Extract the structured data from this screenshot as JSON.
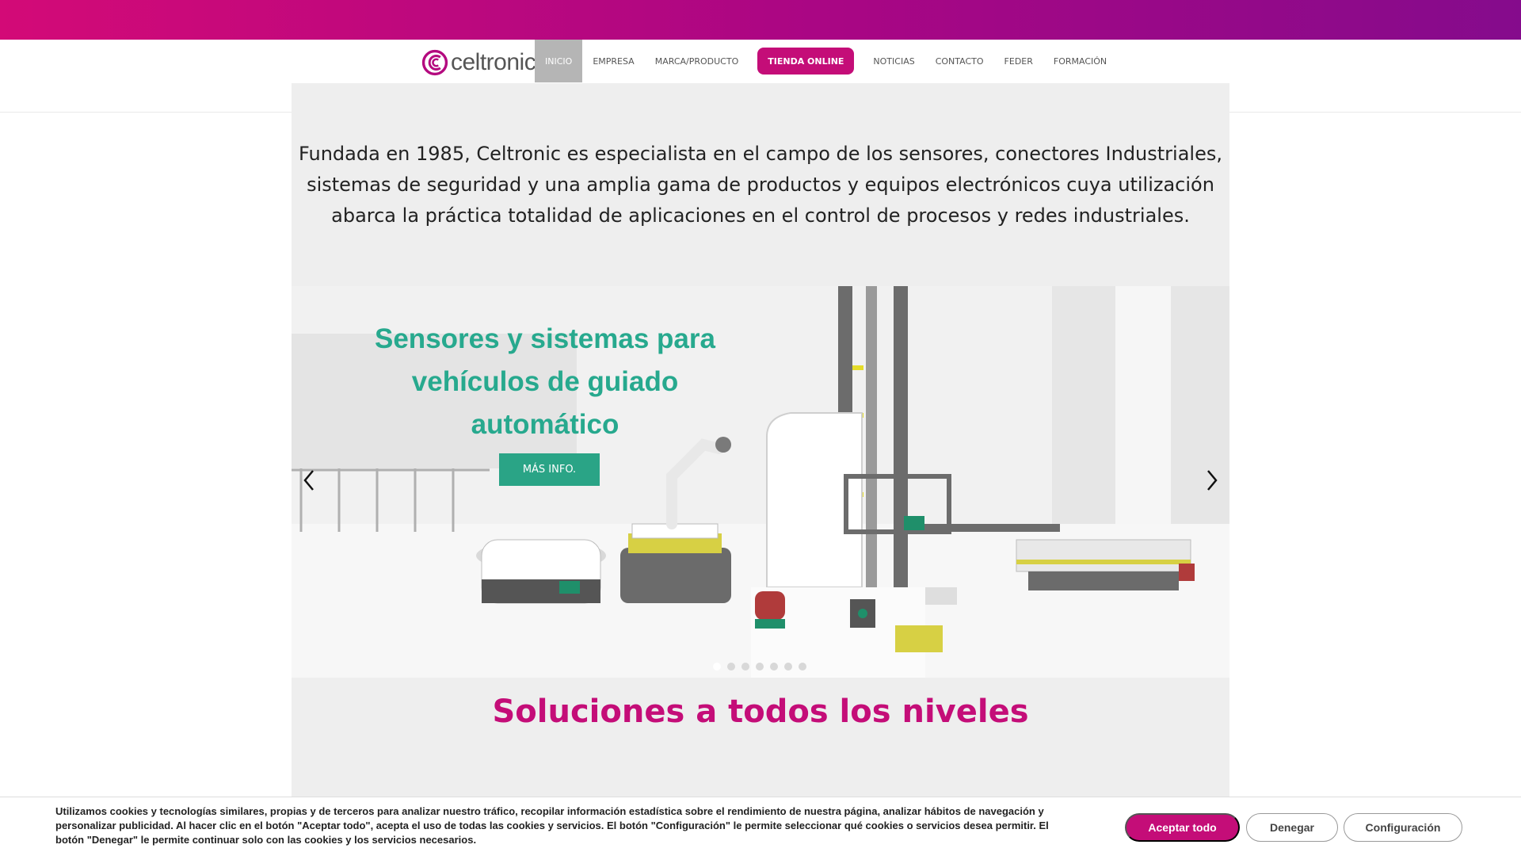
{
  "brand": {
    "name": "celtronic",
    "accent": "#c40d78",
    "green": "#27a98e"
  },
  "nav": {
    "items": [
      {
        "label": "INICIO"
      },
      {
        "label": "EMPRESA"
      },
      {
        "label": "MARCA/PRODUCTO"
      },
      {
        "label": "TIENDA ONLINE"
      },
      {
        "label": "NOTICIAS"
      },
      {
        "label": "CONTACTO"
      },
      {
        "label": "FEDER"
      },
      {
        "label": "FORMACIÓN"
      }
    ],
    "active": "INICIO"
  },
  "intro": {
    "text": "Fundada en 1985, Celtronic es especialista en el campo de los sensores, conectores Industriales, sistemas de seguridad y una amplia gama de productos y equipos electrónicos cuya utilización abarca la práctica totalidad de aplicaciones en el control de procesos y redes industriales."
  },
  "slider": {
    "title": "Sensores y sistemas para vehículos de guiado automático",
    "button": "MÁS INFO.",
    "image_alt": "Vehículos de guiado automático con sensores",
    "slide_count": 7,
    "active_slide": 1
  },
  "section": {
    "title": "Soluciones a todos los niveles"
  },
  "cookie": {
    "text": "Utilizamos cookies y tecnologías similares, propias y de terceros para analizar nuestro tráfico, recopilar información estadística sobre el rendimiento de nuestra página, analizar hábitos de navegación y personalizar publicidad. Al hacer clic en el botón \"Aceptar todo\", acepta el uso de todas las cookies y servicios. El botón \"Configuración\" le permite seleccionar qué cookies o servicios desea permitir. El botón \"Denegar\" le permite continuar solo con las cookies y los servicios necesarios.",
    "accept": "Aceptar todo",
    "deny": "Denegar",
    "config": "Configuración"
  }
}
